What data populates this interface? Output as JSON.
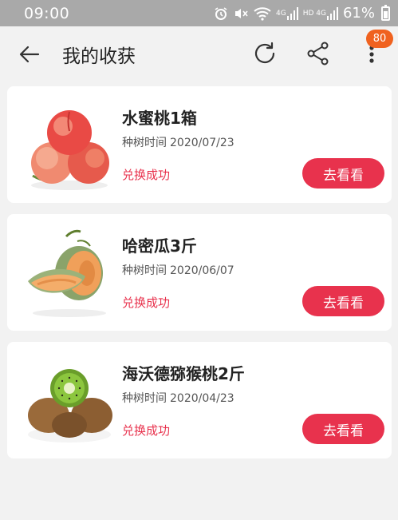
{
  "status_bar": {
    "time": "09:00",
    "battery": "61%",
    "network_1": "4G",
    "network_2": "HD 4G",
    "battery_level": 0.61
  },
  "header": {
    "title": "我的收获",
    "badge_count": "80",
    "icons": [
      "back-arrow-icon",
      "refresh-icon",
      "share-icon",
      "more-icon"
    ]
  },
  "items": [
    {
      "name": "水蜜桃1箱",
      "date_label": "种树时间",
      "date": "2020/07/23",
      "status": "兑换成功",
      "button": "去看看",
      "image": "peach-icon"
    },
    {
      "name": "哈密瓜3斤",
      "date_label": "种树时间",
      "date": "2020/06/07",
      "status": "兑换成功",
      "button": "去看看",
      "image": "melon-icon"
    },
    {
      "name": "海沃德猕猴桃2斤",
      "date_label": "种树时间",
      "date": "2020/04/23",
      "status": "兑换成功",
      "button": "去看看",
      "image": "kiwi-icon"
    }
  ],
  "colors": {
    "accent": "#e8324d",
    "badge": "#f0621f",
    "status_bar": "#a9a9a9",
    "background": "#f2f2f2"
  }
}
